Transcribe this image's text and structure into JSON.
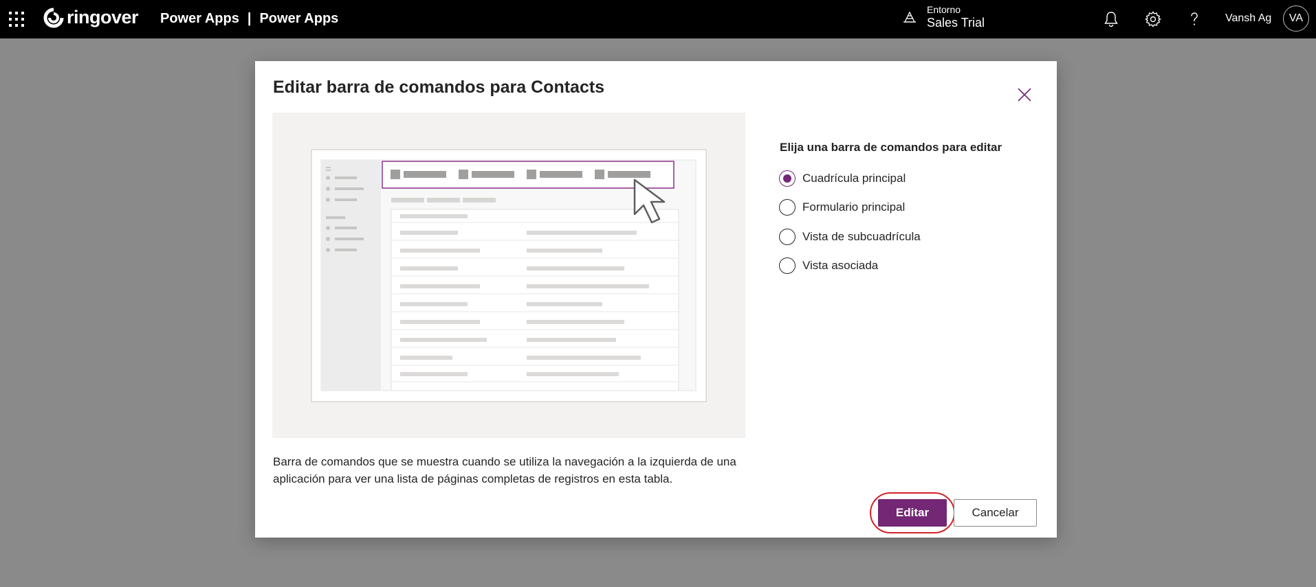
{
  "header": {
    "brand": "ringover",
    "app_title_left": "Power Apps",
    "app_title_separator": "|",
    "app_title_right": "Power Apps",
    "environment_label": "Entorno",
    "environment_name": "Sales Trial",
    "user_name": "Vansh Ag",
    "user_initials": "VA",
    "icons": [
      "waffle-icon",
      "environment-icon",
      "bell-icon",
      "gear-icon",
      "help-icon"
    ]
  },
  "dialog": {
    "title": "Editar barra de comandos para Contacts",
    "description": "Barra de comandos que se muestra cuando se utiliza la navegación a la izquierda de una aplicación para ver una lista de páginas completas de registros en esta tabla.",
    "radio_group_title": "Elija una barra de comandos para editar",
    "options": [
      {
        "label": "Cuadrícula principal",
        "selected": true
      },
      {
        "label": "Formulario principal",
        "selected": false
      },
      {
        "label": "Vista de subcuadrícula",
        "selected": false
      },
      {
        "label": "Vista asociada",
        "selected": false
      }
    ],
    "primary_button": "Editar",
    "secondary_button": "Cancelar"
  },
  "colors": {
    "topbar": "#000000",
    "overlay": "#8a8a8a",
    "accent": "#742774",
    "highlight_ring": "#d51f26"
  }
}
